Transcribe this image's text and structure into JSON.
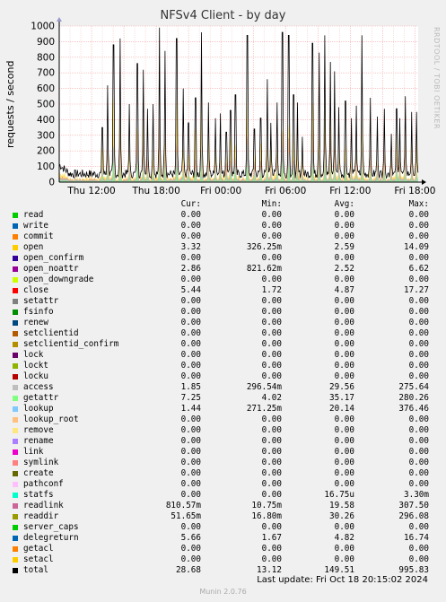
{
  "chart_data": {
    "type": "area",
    "title": "NFSv4 Client - by day",
    "ylabel": "requests / second",
    "ylim": [
      0,
      1000
    ],
    "yticks": [
      "0",
      "100",
      "200",
      "300",
      "400",
      "500",
      "600",
      "700",
      "800",
      "900",
      "1000"
    ],
    "xticks": [
      "Thu 12:00",
      "Thu 18:00",
      "Fri 00:00",
      "Fri 06:00",
      "Fri 12:00",
      "Fri 18:00"
    ],
    "grid": true,
    "peaks": [
      {
        "t": 8.0,
        "v": 350
      },
      {
        "t": 9.0,
        "v": 620
      },
      {
        "t": 10.1,
        "v": 880
      },
      {
        "t": 11.3,
        "v": 920
      },
      {
        "t": 13.0,
        "v": 500
      },
      {
        "t": 14.5,
        "v": 760
      },
      {
        "t": 15.6,
        "v": 720
      },
      {
        "t": 16.4,
        "v": 470
      },
      {
        "t": 17.4,
        "v": 500
      },
      {
        "t": 18.6,
        "v": 990
      },
      {
        "t": 19.6,
        "v": 840
      },
      {
        "t": 21.8,
        "v": 920
      },
      {
        "t": 23.0,
        "v": 600
      },
      {
        "t": 24.0,
        "v": 380
      },
      {
        "t": 25.3,
        "v": 540
      },
      {
        "t": 26.4,
        "v": 960
      },
      {
        "t": 27.7,
        "v": 510
      },
      {
        "t": 29.0,
        "v": 410
      },
      {
        "t": 29.9,
        "v": 440
      },
      {
        "t": 31.0,
        "v": 320
      },
      {
        "t": 31.8,
        "v": 460
      },
      {
        "t": 32.7,
        "v": 560
      },
      {
        "t": 34.9,
        "v": 940
      },
      {
        "t": 36.2,
        "v": 340
      },
      {
        "t": 37.4,
        "v": 410
      },
      {
        "t": 38.6,
        "v": 660
      },
      {
        "t": 39.3,
        "v": 380
      },
      {
        "t": 40.4,
        "v": 510
      },
      {
        "t": 41.4,
        "v": 960
      },
      {
        "t": 42.6,
        "v": 940
      },
      {
        "t": 43.5,
        "v": 560
      },
      {
        "t": 44.2,
        "v": 510
      },
      {
        "t": 45.1,
        "v": 290
      },
      {
        "t": 47.0,
        "v": 890
      },
      {
        "t": 48.2,
        "v": 830
      },
      {
        "t": 49.3,
        "v": 940
      },
      {
        "t": 50.3,
        "v": 770
      },
      {
        "t": 51.1,
        "v": 710
      },
      {
        "t": 51.9,
        "v": 480
      },
      {
        "t": 53.1,
        "v": 520
      },
      {
        "t": 54.2,
        "v": 410
      },
      {
        "t": 55.1,
        "v": 490
      },
      {
        "t": 56.2,
        "v": 940
      },
      {
        "t": 57.7,
        "v": 540
      },
      {
        "t": 59.0,
        "v": 420
      },
      {
        "t": 60.3,
        "v": 470
      },
      {
        "t": 61.6,
        "v": 310
      },
      {
        "t": 62.6,
        "v": 470
      },
      {
        "t": 63.2,
        "v": 410
      },
      {
        "t": 64.2,
        "v": 550
      },
      {
        "t": 65.4,
        "v": 450
      },
      {
        "t": 66.3,
        "v": 450
      }
    ]
  },
  "legend": {
    "headers": [
      "Cur:",
      "Min:",
      "Avg:",
      "Max:"
    ],
    "rows": [
      {
        "name": "read",
        "color": "#00cc00",
        "cur": "0.00",
        "min": "0.00",
        "avg": "0.00",
        "max": "0.00"
      },
      {
        "name": "write",
        "color": "#0066b3",
        "cur": "0.00",
        "min": "0.00",
        "avg": "0.00",
        "max": "0.00"
      },
      {
        "name": "commit",
        "color": "#ff8000",
        "cur": "0.00",
        "min": "0.00",
        "avg": "0.00",
        "max": "0.00"
      },
      {
        "name": "open",
        "color": "#ffcc00",
        "cur": "3.32",
        "min": "326.25m",
        "avg": "2.59",
        "max": "14.09"
      },
      {
        "name": "open_confirm",
        "color": "#330099",
        "cur": "0.00",
        "min": "0.00",
        "avg": "0.00",
        "max": "0.00"
      },
      {
        "name": "open_noattr",
        "color": "#990099",
        "cur": "2.86",
        "min": "821.62m",
        "avg": "2.52",
        "max": "6.62"
      },
      {
        "name": "open_downgrade",
        "color": "#ccff00",
        "cur": "0.00",
        "min": "0.00",
        "avg": "0.00",
        "max": "0.00"
      },
      {
        "name": "close",
        "color": "#ff0000",
        "cur": "5.44",
        "min": "1.72",
        "avg": "4.87",
        "max": "17.27"
      },
      {
        "name": "setattr",
        "color": "#808080",
        "cur": "0.00",
        "min": "0.00",
        "avg": "0.00",
        "max": "0.00"
      },
      {
        "name": "fsinfo",
        "color": "#008f00",
        "cur": "0.00",
        "min": "0.00",
        "avg": "0.00",
        "max": "0.00"
      },
      {
        "name": "renew",
        "color": "#00487d",
        "cur": "0.00",
        "min": "0.00",
        "avg": "0.00",
        "max": "0.00"
      },
      {
        "name": "setclientid",
        "color": "#b35a00",
        "cur": "0.00",
        "min": "0.00",
        "avg": "0.00",
        "max": "0.00"
      },
      {
        "name": "setclientid_confirm",
        "color": "#b38f00",
        "cur": "0.00",
        "min": "0.00",
        "avg": "0.00",
        "max": "0.00"
      },
      {
        "name": "lock",
        "color": "#6b006b",
        "cur": "0.00",
        "min": "0.00",
        "avg": "0.00",
        "max": "0.00"
      },
      {
        "name": "lockt",
        "color": "#8fb300",
        "cur": "0.00",
        "min": "0.00",
        "avg": "0.00",
        "max": "0.00"
      },
      {
        "name": "locku",
        "color": "#b30000",
        "cur": "0.00",
        "min": "0.00",
        "avg": "0.00",
        "max": "0.00"
      },
      {
        "name": "access",
        "color": "#bebebe",
        "cur": "1.85",
        "min": "296.54m",
        "avg": "29.56",
        "max": "275.64"
      },
      {
        "name": "getattr",
        "color": "#80ff80",
        "cur": "7.25",
        "min": "4.02",
        "avg": "35.17",
        "max": "280.26"
      },
      {
        "name": "lookup",
        "color": "#80c9ff",
        "cur": "1.44",
        "min": "271.25m",
        "avg": "20.14",
        "max": "376.46"
      },
      {
        "name": "lookup_root",
        "color": "#ffc080",
        "cur": "0.00",
        "min": "0.00",
        "avg": "0.00",
        "max": "0.00"
      },
      {
        "name": "remove",
        "color": "#ffe680",
        "cur": "0.00",
        "min": "0.00",
        "avg": "0.00",
        "max": "0.00"
      },
      {
        "name": "rename",
        "color": "#aa80ff",
        "cur": "0.00",
        "min": "0.00",
        "avg": "0.00",
        "max": "0.00"
      },
      {
        "name": "link",
        "color": "#ee00cc",
        "cur": "0.00",
        "min": "0.00",
        "avg": "0.00",
        "max": "0.00"
      },
      {
        "name": "symlink",
        "color": "#ff8080",
        "cur": "0.00",
        "min": "0.00",
        "avg": "0.00",
        "max": "0.00"
      },
      {
        "name": "create",
        "color": "#666600",
        "cur": "0.00",
        "min": "0.00",
        "avg": "0.00",
        "max": "0.00"
      },
      {
        "name": "pathconf",
        "color": "#ffbfff",
        "cur": "0.00",
        "min": "0.00",
        "avg": "0.00",
        "max": "0.00"
      },
      {
        "name": "statfs",
        "color": "#00ffcc",
        "cur": "0.00",
        "min": "0.00",
        "avg": "16.75u",
        "max": "3.30m"
      },
      {
        "name": "readlink",
        "color": "#cc6699",
        "cur": "810.57m",
        "min": "10.75m",
        "avg": "19.58",
        "max": "307.50"
      },
      {
        "name": "readdir",
        "color": "#999900",
        "cur": "51.65m",
        "min": "16.80m",
        "avg": "30.26",
        "max": "296.08"
      },
      {
        "name": "server_caps",
        "color": "#00cc00",
        "cur": "0.00",
        "min": "0.00",
        "avg": "0.00",
        "max": "0.00"
      },
      {
        "name": "delegreturn",
        "color": "#0066b3",
        "cur": "5.66",
        "min": "1.67",
        "avg": "4.82",
        "max": "16.74"
      },
      {
        "name": "getacl",
        "color": "#ff8000",
        "cur": "0.00",
        "min": "0.00",
        "avg": "0.00",
        "max": "0.00"
      },
      {
        "name": "setacl",
        "color": "#ffcc00",
        "cur": "0.00",
        "min": "0.00",
        "avg": "0.00",
        "max": "0.00"
      },
      {
        "name": "total",
        "color": "#000000",
        "cur": "28.68",
        "min": "13.12",
        "avg": "149.51",
        "max": "995.83"
      }
    ]
  },
  "watermark": "RRDTOOL / TOBI OETIKER",
  "last_update": "Last update:  Fri Oct 18 20:15:02 2024",
  "footer": "Munin 2.0.76"
}
